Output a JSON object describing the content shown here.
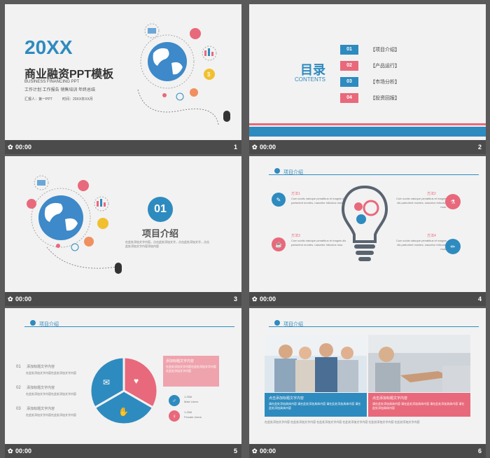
{
  "slides": [
    {
      "num": "1",
      "time": "00:00",
      "year": "20XX",
      "title": "商业融资PPT模板",
      "subtitle_en": "BUSINESS FINANCING PPT",
      "tagline": "工作计划 工作报告 销售培训 年终总结",
      "reporter": "汇报人：第一PPT",
      "date": "时间：20XX年XX月"
    },
    {
      "num": "2",
      "time": "00:00",
      "toc_title": "目录",
      "toc_sub": "CONTENTS",
      "items": [
        {
          "n": "01",
          "label": "【项目介绍】",
          "color": "#2e8bbf"
        },
        {
          "n": "02",
          "label": "【产品运行】",
          "color": "#e8697b"
        },
        {
          "n": "03",
          "label": "【市场分析】",
          "color": "#2e8bbf"
        },
        {
          "n": "04",
          "label": "【投资回报】",
          "color": "#e8697b"
        }
      ]
    },
    {
      "num": "3",
      "time": "00:00",
      "section_num": "01",
      "section_title": "项目介绍",
      "desc": "在此处添加文字内容，点击此处添加文字，点击此处添加文字，点击此处添加文字内容添加内容"
    },
    {
      "num": "4",
      "time": "00:00",
      "header": "项目介绍",
      "blocks": [
        {
          "title": "方法1",
          "text": "Cum sociis natoque penatibus et magnis dis parturient montes, nascetur ridiculus mus."
        },
        {
          "title": "方法2",
          "text": "Cum sociis natoque penatibus et magnis dis parturient montes, nascetur ridiculus mus."
        },
        {
          "title": "方法3",
          "text": "Cum sociis natoque penatibus et magnis dis parturient montes, nascetur ridiculus mus."
        },
        {
          "title": "方法4",
          "text": "Cum sociis natoque penatibus et magnis dis parturient montes, nascetur ridiculus mus."
        }
      ]
    },
    {
      "num": "5",
      "time": "00:00",
      "header": "项目介绍",
      "list": [
        {
          "n": "01",
          "title": "添加标题文字内容",
          "text": "在此处添加文字内容在此处添加文字内容"
        },
        {
          "n": "02",
          "title": "添加标题文字内容",
          "text": "在此处添加文字内容在此处添加文字内容"
        },
        {
          "n": "03",
          "title": "添加标题文字内容",
          "text": "在此处添加文字内容在此处添加文字内容"
        }
      ],
      "box_title": "添加标题文字内容",
      "box_text": "在此处添加文字内容在此处添加文字内容在此处添加文字内容",
      "stats": [
        {
          "value": "1.25M",
          "label": "Male Users"
        },
        {
          "value": "1.25M",
          "label": "Female Users"
        }
      ]
    },
    {
      "num": "6",
      "time": "00:00",
      "header": "项目介绍",
      "cap1_title": "点击添加标题文字内容",
      "cap1_text": "请在此处添加具体内容 请在此处添加具体内容 请在此处添加具体内容 请在此处添加具体内容",
      "cap2_title": "点击添加标题文字内容",
      "cap2_text": "请在此处添加具体内容 请在此处添加具体内容 请在此处添加具体内容 请在此处添加具体内容",
      "footer_text": "在此处添加文字内容 在此处添加文字内容 在此处添加文字内容 在此处添加文字内容 在此处添加文字内容 在此处添加文字内容"
    }
  ],
  "colors": {
    "blue": "#2e8bbf",
    "pink": "#e8697b",
    "bar": "#4b4b4b",
    "bg": "#5a5a5a"
  }
}
